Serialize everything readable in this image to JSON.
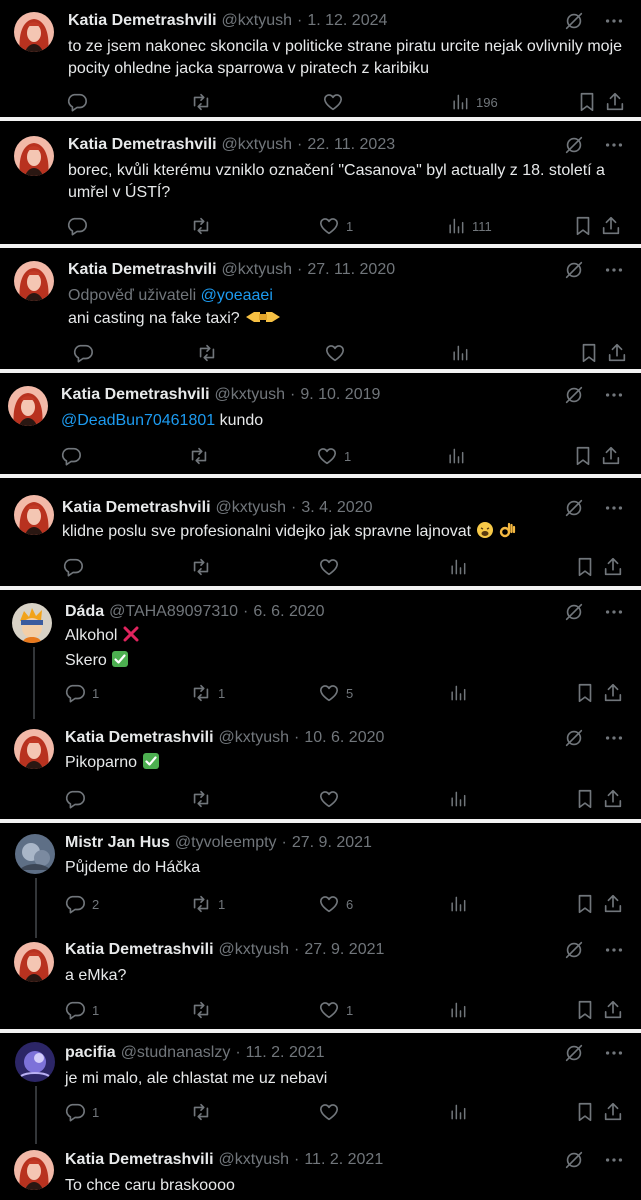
{
  "tweets": [
    {
      "name": "Katia Demetrashvili",
      "handle": "@kxtyush",
      "date": "1. 12. 2024",
      "text": "to ze jsem nakonec skoncila v politicke strane piratu urcite nejak ovlivnily moje pocity ohledne jacka sparrowa v piratech z karibiku",
      "reply": "",
      "like": "",
      "retweet": "",
      "views": "196"
    },
    {
      "name": "Katia Demetrashvili",
      "handle": "@kxtyush",
      "date": "22. 11. 2023",
      "text": "borec, kvůli kterému vzniklo označení \"Casanova\" byl actually z 18. století a umřel v ÚSTÍ?",
      "reply": "",
      "like": "1",
      "retweet": "",
      "views": "111"
    },
    {
      "name": "Katia Demetrashvili",
      "handle": "@kxtyush",
      "date": "27. 11. 2020",
      "reply_prefix": "Odpověď uživateli",
      "reply_to": "@yoeaaei",
      "text": "ani casting na fake taxi?",
      "reply": "",
      "like": "",
      "retweet": "",
      "views": ""
    },
    {
      "name": "Katia Demetrashvili",
      "handle": "@kxtyush",
      "date": "9. 10. 2019",
      "mention": "@DeadBun70461801",
      "text": "kundo",
      "reply": "",
      "like": "1",
      "retweet": "",
      "views": ""
    },
    {
      "name": "Katia Demetrashvili",
      "handle": "@kxtyush",
      "date": "3. 4. 2020",
      "text": "klidne poslu sve profesionalni videjko jak spravne lajnovat",
      "reply": "",
      "like": "",
      "retweet": "",
      "views": ""
    },
    {
      "name": "Dáda",
      "handle": "@TAHA89097310",
      "date": "6. 6. 2020",
      "line1": "Alkohol",
      "line2": "Skero",
      "reply": "1",
      "like": "5",
      "retweet": "1",
      "views": ""
    },
    {
      "name": "Katia Demetrashvili",
      "handle": "@kxtyush",
      "date": "10. 6. 2020",
      "text": "Pikoparno",
      "reply": "",
      "like": "",
      "retweet": "",
      "views": ""
    },
    {
      "name": "Mistr Jan Hus",
      "handle": "@tyvoleempty",
      "date": "27. 9. 2021",
      "text": "Půjdeme do Háčka",
      "reply": "2",
      "like": "6",
      "retweet": "1",
      "views": ""
    },
    {
      "name": "Katia Demetrashvili",
      "handle": "@kxtyush",
      "date": "27. 9. 2021",
      "text": "a eMka?",
      "reply": "1",
      "like": "1",
      "retweet": "",
      "views": ""
    },
    {
      "name": "pacifia",
      "handle": "@studnanaslzy",
      "date": "11. 2. 2021",
      "text": "je mi malo, ale chlastat me uz nebavi",
      "reply": "1",
      "like": "",
      "retweet": "",
      "views": ""
    },
    {
      "name": "Katia Demetrashvili",
      "handle": "@kxtyush",
      "date": "11. 2. 2021",
      "text": "To chce caru braskoooo",
      "reply": "",
      "like": "",
      "retweet": "",
      "views": ""
    }
  ],
  "colors": {
    "background": "#000000",
    "text": "#e7e9ea",
    "muted": "#71767b",
    "link": "#1d9bf0",
    "separator": "#f2f2f2"
  },
  "icons": [
    "reply-icon",
    "retweet-icon",
    "like-icon",
    "views-icon",
    "bookmark-icon",
    "share-icon",
    "grok-icon",
    "more-icon"
  ]
}
